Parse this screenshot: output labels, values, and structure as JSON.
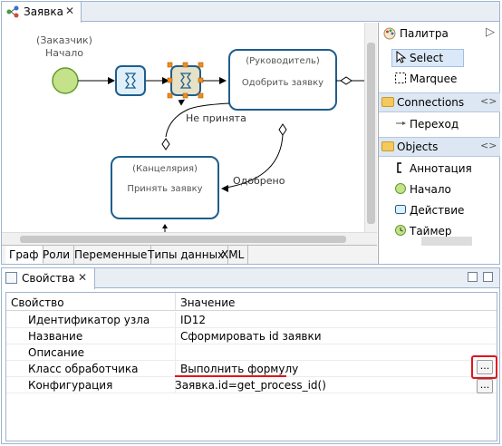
{
  "editor": {
    "tab_label": "Заявка",
    "tab_close": "✕",
    "bottom_tabs": [
      "Граф",
      "Роли",
      "Переменные",
      "Типы данных",
      "XML"
    ]
  },
  "diagram": {
    "start_role": "(Заказчик)",
    "start_label": "Начало",
    "manager_role": "(Руководитель)",
    "manager_task": "Одобрить заявку",
    "office_role": "(Канцелярия)",
    "office_task": "Принять заявку",
    "rejected_label": "Не принята",
    "approved_label": "Одобрено"
  },
  "palette": {
    "title": "Палитра",
    "tools": [
      {
        "label": "Select",
        "icon": "cursor-icon"
      },
      {
        "label": "Marquee",
        "icon": "marquee-icon"
      }
    ],
    "connections_title": "Connections",
    "connections": [
      {
        "label": "Переход",
        "icon": "arrow-icon"
      }
    ],
    "objects_title": "Objects",
    "objects": [
      {
        "label": "Аннотация",
        "icon": "annotation-icon"
      },
      {
        "label": "Начало",
        "icon": "start-event-icon"
      },
      {
        "label": "Действие",
        "icon": "action-icon"
      },
      {
        "label": "Таймер",
        "icon": "timer-icon"
      }
    ]
  },
  "properties": {
    "tab_label": "Свойства",
    "tab_close": "✕",
    "col_property": "Свойство",
    "col_value": "Значение",
    "rows": [
      {
        "name": "Идентификатор узла",
        "value": "ID12"
      },
      {
        "name": "Название",
        "value": "Сформировать id заявки"
      },
      {
        "name": "Описание",
        "value": ""
      },
      {
        "name": "Класс обработчика",
        "value": "Выполнить формулу"
      },
      {
        "name": "Конфигурация",
        "value": "Заявка.id=get_process_id()"
      }
    ],
    "dots_label": "...",
    "highlight_color": "#e0141e"
  }
}
